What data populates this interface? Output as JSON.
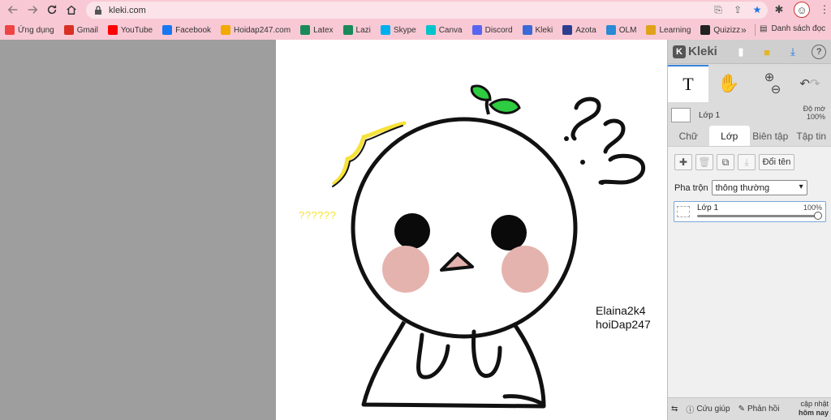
{
  "browser": {
    "url": "kleki.com",
    "bookmarks": [
      {
        "label": "Ứng dụng",
        "icon": "apps-grid-icon",
        "color": "#e44"
      },
      {
        "label": "Gmail",
        "icon": "gmail-icon",
        "color": "#d93025"
      },
      {
        "label": "YouTube",
        "icon": "youtube-icon",
        "color": "#ff0000"
      },
      {
        "label": "Facebook",
        "icon": "facebook-icon",
        "color": "#1877f2"
      },
      {
        "label": "Hoidap247.com",
        "icon": "hoidap-icon",
        "color": "#f2a900"
      },
      {
        "label": "Latex",
        "icon": "latex-icon",
        "color": "#1a8a5a"
      },
      {
        "label": "Lazi",
        "icon": "lazi-icon",
        "color": "#1a8a5a"
      },
      {
        "label": "Skype",
        "icon": "skype-icon",
        "color": "#00aff0"
      },
      {
        "label": "Canva",
        "icon": "canva-icon",
        "color": "#00c4cc"
      },
      {
        "label": "Discord",
        "icon": "discord-icon",
        "color": "#5865f2"
      },
      {
        "label": "Kleki",
        "icon": "kleki-icon",
        "color": "#3a6bd6"
      },
      {
        "label": "Azota",
        "icon": "azota-icon",
        "color": "#2c3e90"
      },
      {
        "label": "OLM",
        "icon": "olm-icon",
        "color": "#2a8ad6"
      },
      {
        "label": "Learning",
        "icon": "learning-icon",
        "color": "#e0a21b"
      },
      {
        "label": "Quizizz",
        "icon": "quizizz-icon",
        "color": "#222222"
      }
    ],
    "more_label": "»",
    "reading_list_label": "Danh sách đọc"
  },
  "canvas": {
    "question_text": "??????",
    "signature_line1": "Elaina2k4",
    "signature_line2": "hoiDap247"
  },
  "panel": {
    "app_name": "Kleki",
    "layer_name": "Lớp 1",
    "opacity_label": "Độ mờ",
    "opacity_value": "100%",
    "tabs": [
      {
        "label": "Chữ",
        "active": false
      },
      {
        "label": "Lớp",
        "active": true
      },
      {
        "label": "Biên tập",
        "active": false
      },
      {
        "label": "Tập tin",
        "active": false
      }
    ],
    "rename_label": "Đổi tên",
    "blend_label": "Pha trộn",
    "blend_value": "thông thường",
    "layer_item_name": "Lớp 1",
    "layer_item_opacity": "100%",
    "layer_item_opacity_fraction": 1.0,
    "footer": {
      "help_label": "Cứu giúp",
      "feedback_label": "Phản hồi",
      "update_line1": "cập nhật",
      "update_line2": "hôm nay"
    }
  },
  "colors": {
    "browser_bar": "#f8c9d4",
    "canvas_bg": "#ffffff",
    "workspace_bg": "#9e9e9e",
    "leaf_green": "#2ecc40",
    "cheek_pink": "#e5b3ae",
    "question_yellow": "#f7e23a"
  }
}
